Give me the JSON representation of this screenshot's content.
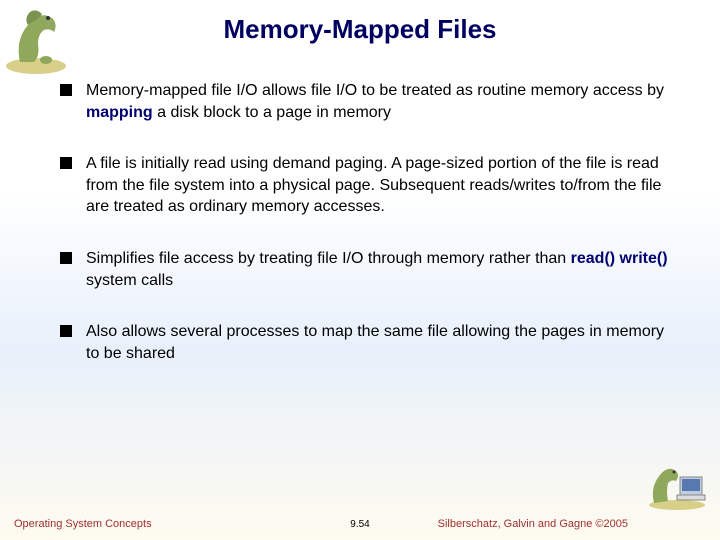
{
  "title": "Memory-Mapped Files",
  "bullets": [
    {
      "pre": "Memory-mapped file I/O allows file I/O to be treated as routine memory access by ",
      "kw": "mapping",
      "post": " a disk block to a page in memory"
    },
    {
      "text": "A file is initially read using demand paging. A page-sized portion of the file is read from the file system into a physical page. Subsequent reads/writes to/from the file are treated as ordinary memory accesses."
    },
    {
      "pre": "Simplifies file access by treating file I/O through memory rather than ",
      "kw": "read() write()",
      "post": " system calls"
    },
    {
      "text": "Also allows several processes to map the same file allowing the pages in memory to be shared"
    }
  ],
  "footer": {
    "left": "Operating System Concepts",
    "center": "9.54",
    "right": "Silberschatz, Galvin and Gagne ©2005"
  }
}
